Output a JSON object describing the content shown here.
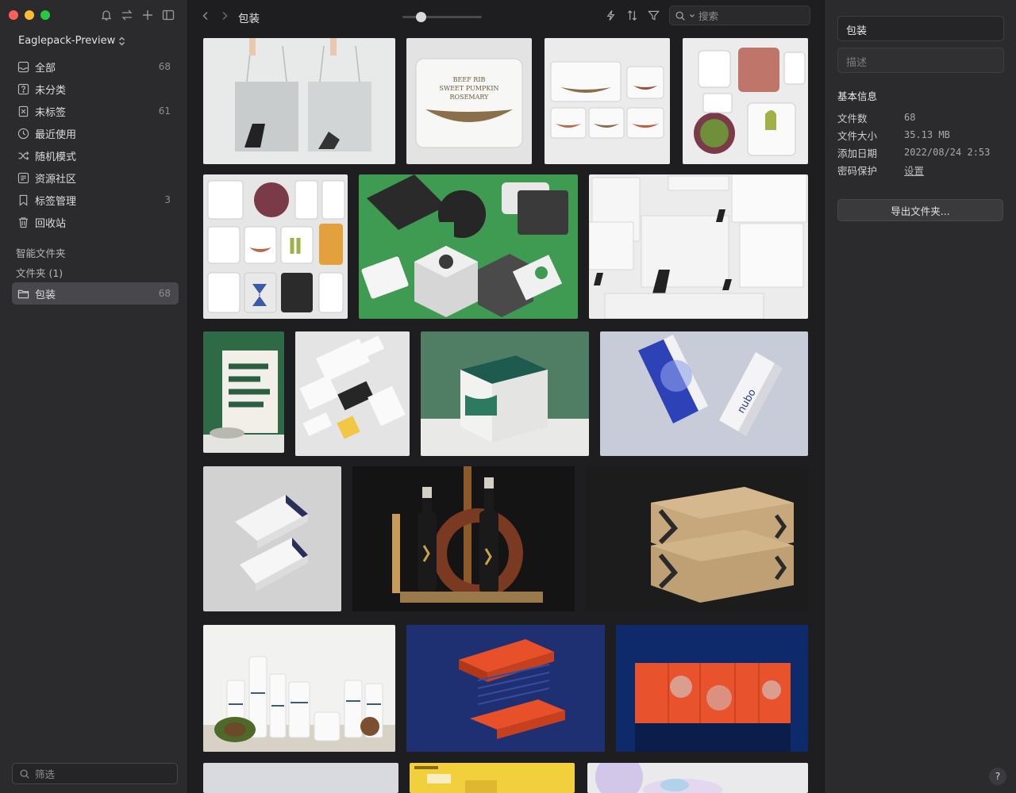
{
  "sidebar": {
    "library_name": "Eaglepack-Preview",
    "items": [
      {
        "label": "全部",
        "count": "68",
        "icon": "inbox-icon"
      },
      {
        "label": "未分类",
        "count": "",
        "icon": "question-square-icon"
      },
      {
        "label": "未标签",
        "count": "61",
        "icon": "untagged-icon"
      },
      {
        "label": "最近使用",
        "count": "",
        "icon": "clock-icon"
      },
      {
        "label": "随机模式",
        "count": "",
        "icon": "shuffle-icon"
      },
      {
        "label": "资源社区",
        "count": "",
        "icon": "community-icon"
      },
      {
        "label": "标签管理",
        "count": "3",
        "icon": "tag-icon"
      },
      {
        "label": "回收站",
        "count": "",
        "icon": "trash-icon"
      }
    ],
    "smart_folders_label": "智能文件夹",
    "folders_label": "文件夹 (1)",
    "folder": {
      "label": "包装",
      "count": "68"
    },
    "filter_placeholder": "筛选"
  },
  "toolbar": {
    "title": "包装",
    "search_placeholder": "搜索",
    "zoom_level": 0.2
  },
  "inspector": {
    "name_value": "包装",
    "desc_placeholder": "描述",
    "info_title": "基本信息",
    "rows": [
      {
        "key": "文件数",
        "value": "68"
      },
      {
        "key": "文件大小",
        "value": "35.13 MB"
      },
      {
        "key": "添加日期",
        "value": "2022/08/24 2:53"
      },
      {
        "key": "密码保护",
        "value": "设置"
      }
    ],
    "export_label": "导出文件夹...",
    "help_label": "?"
  },
  "colors": {
    "sidebar_bg": "#2b2b2e",
    "main_bg": "#1e1e20",
    "active_item": "#48484c"
  }
}
